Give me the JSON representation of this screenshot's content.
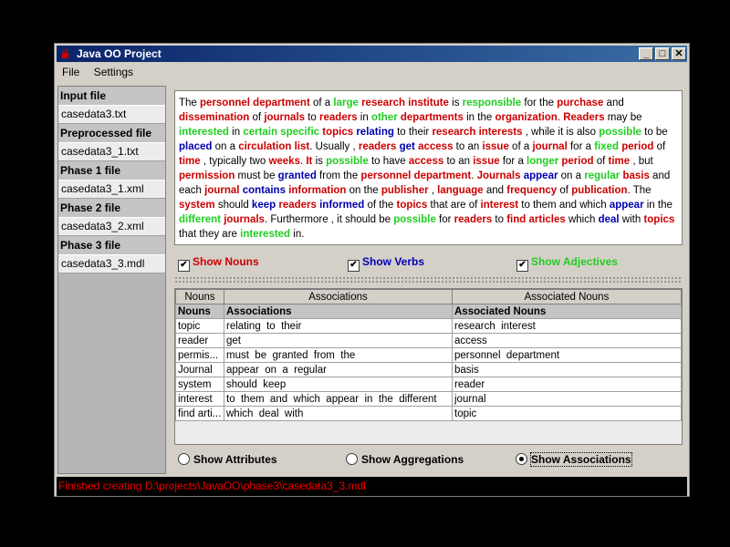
{
  "window": {
    "title": "Java OO Project",
    "min": "_",
    "max": "□",
    "close": "✕"
  },
  "menu": [
    "File",
    "Settings"
  ],
  "sidebar": [
    {
      "label": "Input file",
      "value": "casedata3.txt"
    },
    {
      "label": "Preprocessed file",
      "value": "casedata3_1.txt"
    },
    {
      "label": "Phase 1 file",
      "value": "casedata3_1.xml"
    },
    {
      "label": "Phase 2 file",
      "value": "casedata3_2.xml"
    },
    {
      "label": "Phase 3 file",
      "value": "casedata3_3.mdl"
    }
  ],
  "paragraph": [
    [
      "t",
      " The "
    ],
    [
      "n",
      "personnel department"
    ],
    [
      "t",
      " of a "
    ],
    [
      "a",
      "large"
    ],
    [
      "t",
      " "
    ],
    [
      "n",
      "research institute"
    ],
    [
      "t",
      " is "
    ],
    [
      "a",
      "responsible"
    ],
    [
      "t",
      " for the "
    ],
    [
      "n",
      "purchase"
    ],
    [
      "t",
      " and "
    ],
    [
      "n",
      "dissemination"
    ],
    [
      "t",
      " of "
    ],
    [
      "n",
      "journals"
    ],
    [
      "t",
      " to "
    ],
    [
      "n",
      "readers"
    ],
    [
      "t",
      " in "
    ],
    [
      "a",
      "other"
    ],
    [
      "t",
      " "
    ],
    [
      "n",
      "departments"
    ],
    [
      "t",
      " in the "
    ],
    [
      "n",
      "organization"
    ],
    [
      "t",
      ". "
    ],
    [
      "n",
      "Readers"
    ],
    [
      "t",
      " may be "
    ],
    [
      "a",
      "interested"
    ],
    [
      "t",
      " in "
    ],
    [
      "a",
      "certain specific"
    ],
    [
      "t",
      " "
    ],
    [
      "n",
      "topics"
    ],
    [
      "t",
      " "
    ],
    [
      "v",
      "relating"
    ],
    [
      "t",
      " to their "
    ],
    [
      "n",
      "research interests"
    ],
    [
      "t",
      " , while it is also "
    ],
    [
      "a",
      "possible"
    ],
    [
      "t",
      " "
    ],
    [
      "t",
      "to be "
    ],
    [
      "v",
      "placed"
    ],
    [
      "t",
      " on a "
    ],
    [
      "n",
      "circulation list"
    ],
    [
      "t",
      ". Usually , "
    ],
    [
      "n",
      "readers"
    ],
    [
      "t",
      " "
    ],
    [
      "v",
      "get"
    ],
    [
      "t",
      " "
    ],
    [
      "n",
      "access"
    ],
    [
      "t",
      " to an "
    ],
    [
      "n",
      "issue"
    ],
    [
      "t",
      " of a "
    ],
    [
      "n",
      "journal"
    ],
    [
      "t",
      " for a "
    ],
    [
      "a",
      "fixed"
    ],
    [
      "t",
      " "
    ],
    [
      "n",
      "period"
    ],
    [
      "t",
      " of "
    ],
    [
      "n",
      "time"
    ],
    [
      "t",
      " , typically two "
    ],
    [
      "n",
      "weeks"
    ],
    [
      "t",
      ". "
    ],
    [
      "n",
      "It"
    ],
    [
      "t",
      " is "
    ],
    [
      "a",
      "possible"
    ],
    [
      "t",
      " to have "
    ],
    [
      "n",
      "access"
    ],
    [
      "t",
      " to an "
    ],
    [
      "n",
      "issue"
    ],
    [
      "t",
      " for a "
    ],
    [
      "a",
      "longer"
    ],
    [
      "t",
      " "
    ],
    [
      "n",
      "period"
    ],
    [
      "t",
      " of "
    ],
    [
      "n",
      "time"
    ],
    [
      "t",
      " , but "
    ],
    [
      "n",
      "permission"
    ],
    [
      "t",
      " must be "
    ],
    [
      "v",
      "granted"
    ],
    [
      "t",
      " from the "
    ],
    [
      "n",
      "personnel department"
    ],
    [
      "t",
      ". "
    ],
    [
      "n",
      "Journals"
    ],
    [
      "t",
      " "
    ],
    [
      "v",
      "appear"
    ],
    [
      "t",
      " on a "
    ],
    [
      "a",
      "regular"
    ],
    [
      "t",
      " "
    ],
    [
      "n",
      "basis"
    ],
    [
      "t",
      " and each "
    ],
    [
      "n",
      "journal"
    ],
    [
      "t",
      " "
    ],
    [
      "v",
      "contains"
    ],
    [
      "t",
      " "
    ],
    [
      "n",
      "information"
    ],
    [
      "t",
      " on the "
    ],
    [
      "n",
      "publisher"
    ],
    [
      "t",
      " , "
    ],
    [
      "n",
      "language"
    ],
    [
      "t",
      " and "
    ],
    [
      "n",
      "frequency"
    ],
    [
      "t",
      " of "
    ],
    [
      "n",
      "publication"
    ],
    [
      "t",
      ". The "
    ],
    [
      "n",
      "system"
    ],
    [
      "t",
      " should "
    ],
    [
      "v",
      "keep"
    ],
    [
      "t",
      " "
    ],
    [
      "n",
      "readers"
    ],
    [
      "t",
      " "
    ],
    [
      "v",
      "informed"
    ],
    [
      "t",
      " of the "
    ],
    [
      "n",
      "topics"
    ],
    [
      "t",
      " that are of "
    ],
    [
      "n",
      "interest"
    ],
    [
      "t",
      " to them "
    ],
    [
      "t",
      "and which "
    ],
    [
      "v",
      "appear"
    ],
    [
      "t",
      " in the "
    ],
    [
      "a",
      "different"
    ],
    [
      "t",
      " "
    ],
    [
      "n",
      "journals"
    ],
    [
      "t",
      ". Furthermore , it should be "
    ],
    [
      "a",
      "possible"
    ],
    [
      "t",
      " for "
    ],
    [
      "n",
      "readers"
    ],
    [
      "t",
      " to "
    ],
    [
      "n",
      "find"
    ],
    [
      "t",
      " "
    ],
    [
      "n",
      "articles"
    ],
    [
      "t",
      " which "
    ],
    [
      "v",
      "deal"
    ],
    [
      "t",
      " with "
    ],
    [
      "n",
      "topics"
    ],
    [
      "t",
      " that they are "
    ],
    [
      "a",
      "interested"
    ],
    [
      "t",
      " in."
    ]
  ],
  "checkboxes": [
    {
      "label": "Show Nouns",
      "checked": true,
      "color": "#cc0000"
    },
    {
      "label": "Show Verbs",
      "checked": true,
      "color": "#0000b0"
    },
    {
      "label": "Show Adjectives",
      "checked": true,
      "color": "#22cc22"
    }
  ],
  "table": {
    "columns": [
      "Nouns",
      "Associations",
      "Associated Nouns"
    ],
    "header_row": [
      "Nouns",
      "Associations",
      "Associated Nouns"
    ],
    "rows": [
      [
        "topic",
        "relating  to  their",
        "research  interest"
      ],
      [
        "reader",
        "get",
        "access"
      ],
      [
        "permis...",
        "must  be  granted  from  the",
        "personnel  department"
      ],
      [
        "Journal",
        "appear  on  a  regular",
        "basis"
      ],
      [
        "system",
        "should  keep",
        "reader"
      ],
      [
        "interest",
        "to  them  and  which  appear  in  the  different",
        "journal"
      ],
      [
        "find arti...",
        "which  deal  with",
        "topic"
      ]
    ]
  },
  "radios": [
    {
      "label": "Show Attributes",
      "selected": false
    },
    {
      "label": "Show Aggregations",
      "selected": false
    },
    {
      "label": "Show Associations",
      "selected": true
    }
  ],
  "status": "Finished creating D:\\projects\\JavaOO\\phase3\\casedata3_3.mdl"
}
